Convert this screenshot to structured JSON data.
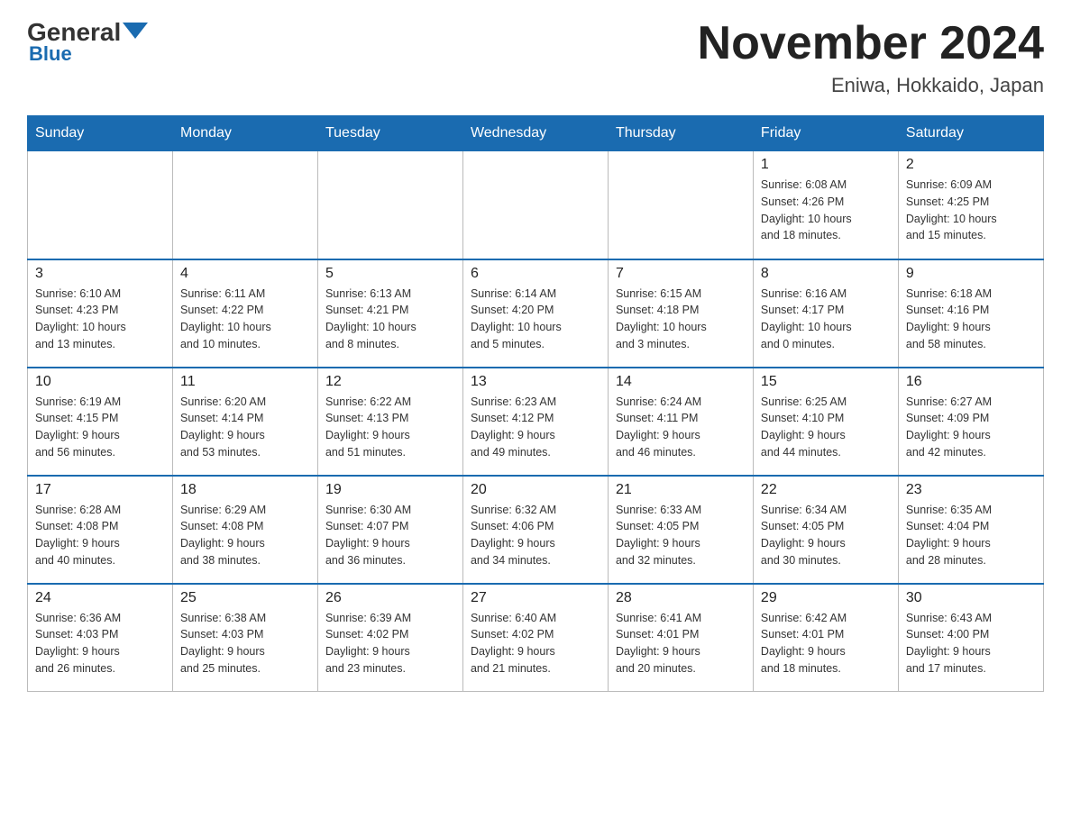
{
  "header": {
    "logo": {
      "general": "General",
      "blue": "Blue"
    },
    "title": "November 2024",
    "location": "Eniwa, Hokkaido, Japan"
  },
  "days_of_week": [
    "Sunday",
    "Monday",
    "Tuesday",
    "Wednesday",
    "Thursday",
    "Friday",
    "Saturday"
  ],
  "weeks": [
    [
      {
        "day": "",
        "info": ""
      },
      {
        "day": "",
        "info": ""
      },
      {
        "day": "",
        "info": ""
      },
      {
        "day": "",
        "info": ""
      },
      {
        "day": "",
        "info": ""
      },
      {
        "day": "1",
        "info": "Sunrise: 6:08 AM\nSunset: 4:26 PM\nDaylight: 10 hours\nand 18 minutes."
      },
      {
        "day": "2",
        "info": "Sunrise: 6:09 AM\nSunset: 4:25 PM\nDaylight: 10 hours\nand 15 minutes."
      }
    ],
    [
      {
        "day": "3",
        "info": "Sunrise: 6:10 AM\nSunset: 4:23 PM\nDaylight: 10 hours\nand 13 minutes."
      },
      {
        "day": "4",
        "info": "Sunrise: 6:11 AM\nSunset: 4:22 PM\nDaylight: 10 hours\nand 10 minutes."
      },
      {
        "day": "5",
        "info": "Sunrise: 6:13 AM\nSunset: 4:21 PM\nDaylight: 10 hours\nand 8 minutes."
      },
      {
        "day": "6",
        "info": "Sunrise: 6:14 AM\nSunset: 4:20 PM\nDaylight: 10 hours\nand 5 minutes."
      },
      {
        "day": "7",
        "info": "Sunrise: 6:15 AM\nSunset: 4:18 PM\nDaylight: 10 hours\nand 3 minutes."
      },
      {
        "day": "8",
        "info": "Sunrise: 6:16 AM\nSunset: 4:17 PM\nDaylight: 10 hours\nand 0 minutes."
      },
      {
        "day": "9",
        "info": "Sunrise: 6:18 AM\nSunset: 4:16 PM\nDaylight: 9 hours\nand 58 minutes."
      }
    ],
    [
      {
        "day": "10",
        "info": "Sunrise: 6:19 AM\nSunset: 4:15 PM\nDaylight: 9 hours\nand 56 minutes."
      },
      {
        "day": "11",
        "info": "Sunrise: 6:20 AM\nSunset: 4:14 PM\nDaylight: 9 hours\nand 53 minutes."
      },
      {
        "day": "12",
        "info": "Sunrise: 6:22 AM\nSunset: 4:13 PM\nDaylight: 9 hours\nand 51 minutes."
      },
      {
        "day": "13",
        "info": "Sunrise: 6:23 AM\nSunset: 4:12 PM\nDaylight: 9 hours\nand 49 minutes."
      },
      {
        "day": "14",
        "info": "Sunrise: 6:24 AM\nSunset: 4:11 PM\nDaylight: 9 hours\nand 46 minutes."
      },
      {
        "day": "15",
        "info": "Sunrise: 6:25 AM\nSunset: 4:10 PM\nDaylight: 9 hours\nand 44 minutes."
      },
      {
        "day": "16",
        "info": "Sunrise: 6:27 AM\nSunset: 4:09 PM\nDaylight: 9 hours\nand 42 minutes."
      }
    ],
    [
      {
        "day": "17",
        "info": "Sunrise: 6:28 AM\nSunset: 4:08 PM\nDaylight: 9 hours\nand 40 minutes."
      },
      {
        "day": "18",
        "info": "Sunrise: 6:29 AM\nSunset: 4:08 PM\nDaylight: 9 hours\nand 38 minutes."
      },
      {
        "day": "19",
        "info": "Sunrise: 6:30 AM\nSunset: 4:07 PM\nDaylight: 9 hours\nand 36 minutes."
      },
      {
        "day": "20",
        "info": "Sunrise: 6:32 AM\nSunset: 4:06 PM\nDaylight: 9 hours\nand 34 minutes."
      },
      {
        "day": "21",
        "info": "Sunrise: 6:33 AM\nSunset: 4:05 PM\nDaylight: 9 hours\nand 32 minutes."
      },
      {
        "day": "22",
        "info": "Sunrise: 6:34 AM\nSunset: 4:05 PM\nDaylight: 9 hours\nand 30 minutes."
      },
      {
        "day": "23",
        "info": "Sunrise: 6:35 AM\nSunset: 4:04 PM\nDaylight: 9 hours\nand 28 minutes."
      }
    ],
    [
      {
        "day": "24",
        "info": "Sunrise: 6:36 AM\nSunset: 4:03 PM\nDaylight: 9 hours\nand 26 minutes."
      },
      {
        "day": "25",
        "info": "Sunrise: 6:38 AM\nSunset: 4:03 PM\nDaylight: 9 hours\nand 25 minutes."
      },
      {
        "day": "26",
        "info": "Sunrise: 6:39 AM\nSunset: 4:02 PM\nDaylight: 9 hours\nand 23 minutes."
      },
      {
        "day": "27",
        "info": "Sunrise: 6:40 AM\nSunset: 4:02 PM\nDaylight: 9 hours\nand 21 minutes."
      },
      {
        "day": "28",
        "info": "Sunrise: 6:41 AM\nSunset: 4:01 PM\nDaylight: 9 hours\nand 20 minutes."
      },
      {
        "day": "29",
        "info": "Sunrise: 6:42 AM\nSunset: 4:01 PM\nDaylight: 9 hours\nand 18 minutes."
      },
      {
        "day": "30",
        "info": "Sunrise: 6:43 AM\nSunset: 4:00 PM\nDaylight: 9 hours\nand 17 minutes."
      }
    ]
  ]
}
